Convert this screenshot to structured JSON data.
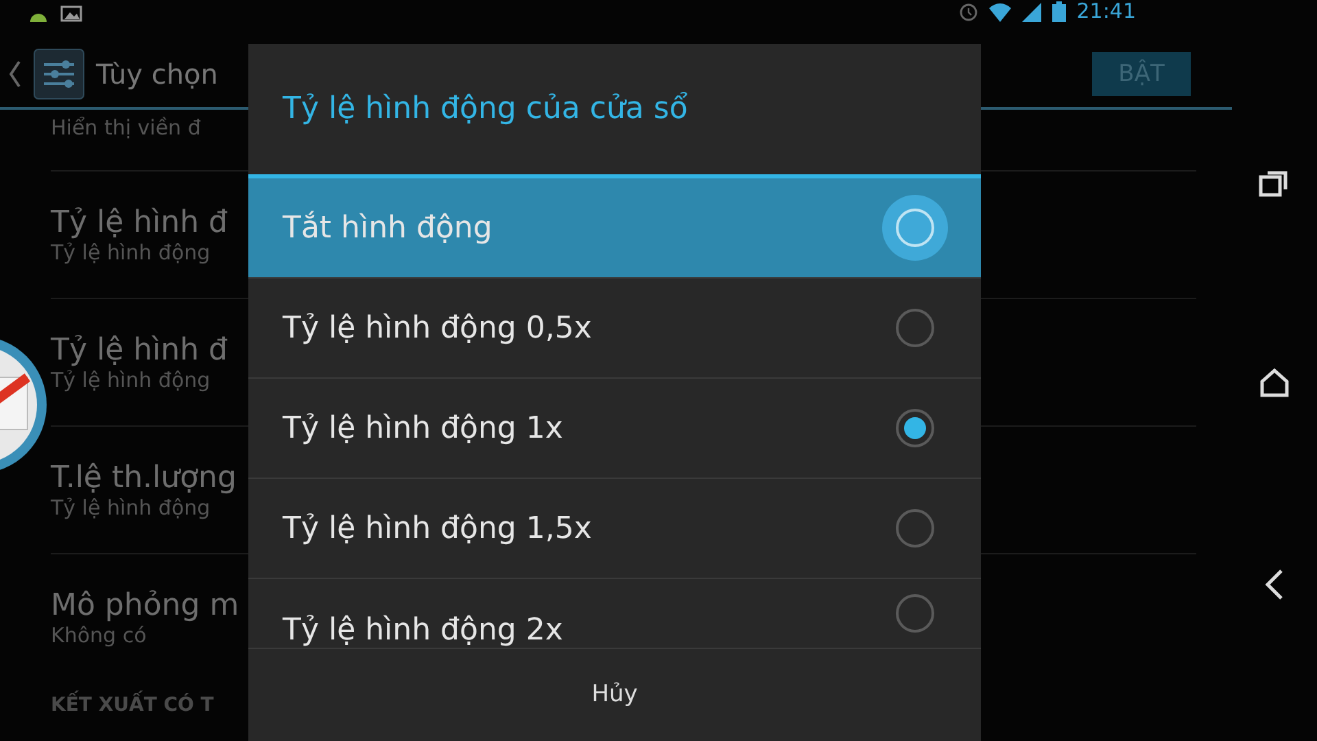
{
  "status_bar": {
    "time": "21:41"
  },
  "action_bar": {
    "title": "Tùy chọn",
    "toggle": "BẬT"
  },
  "settings": {
    "partial_summary": "Hiển thị viền đ",
    "items": [
      {
        "title": "Tỷ lệ hình đ",
        "summary": "Tỷ lệ hình động"
      },
      {
        "title": "Tỷ lệ hình đ",
        "summary": "Tỷ lệ hình động"
      },
      {
        "title": "T.lệ th.lượng",
        "summary": "Tỷ lệ hình động"
      },
      {
        "title": "Mô phỏng m",
        "summary": "Không có"
      }
    ],
    "section_header": "KẾT XUẤT CÓ T"
  },
  "dialog": {
    "title": "Tỷ lệ hình động của cửa sổ",
    "options": [
      {
        "label": "Tắt hình động",
        "selected": false,
        "pressed": true
      },
      {
        "label": "Tỷ lệ hình động 0,5x",
        "selected": false,
        "pressed": false
      },
      {
        "label": "Tỷ lệ hình động 1x",
        "selected": true,
        "pressed": false
      },
      {
        "label": "Tỷ lệ hình động 1,5x",
        "selected": false,
        "pressed": false
      },
      {
        "label": "Tỷ lệ hình động 2x",
        "selected": false,
        "pressed": false
      }
    ],
    "cancel": "Hủy"
  }
}
